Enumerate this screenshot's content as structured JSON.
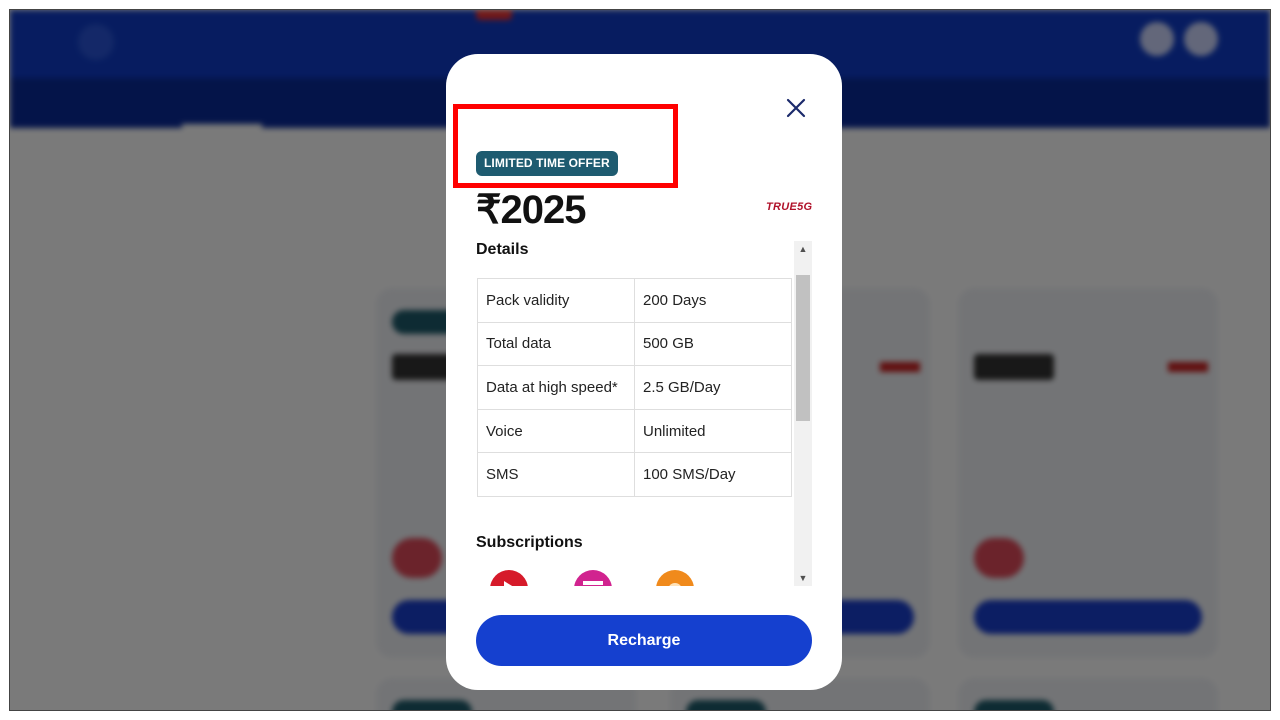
{
  "modal": {
    "offer_badge": "LIMITED TIME OFFER",
    "price": "₹2025",
    "brand_tag": "TRUE5G",
    "details_title": "Details",
    "details": [
      {
        "label": "Pack validity",
        "value": "200 Days"
      },
      {
        "label": "Total data",
        "value": "500 GB"
      },
      {
        "label": "Data at high speed*",
        "value": "2.5 GB/Day"
      },
      {
        "label": "Voice",
        "value": "Unlimited"
      },
      {
        "label": "SMS",
        "value": "100 SMS/Day"
      }
    ],
    "subscriptions_title": "Subscriptions",
    "subscription_icons": [
      {
        "name": "video-app-icon",
        "color": "#d61a2a"
      },
      {
        "name": "cinema-app-icon",
        "color": "#d1238f"
      },
      {
        "name": "cloud-app-icon",
        "color": "#f08a1c"
      }
    ],
    "recharge_label": "Recharge",
    "close_icon": "close-icon"
  },
  "colors": {
    "accent": "#1540cf",
    "offer_badge_bg": "#1e5b70",
    "brand_red": "#b0122a",
    "highlight": "#ff0000",
    "overlay": "rgba(0,0,0,0.52)"
  }
}
